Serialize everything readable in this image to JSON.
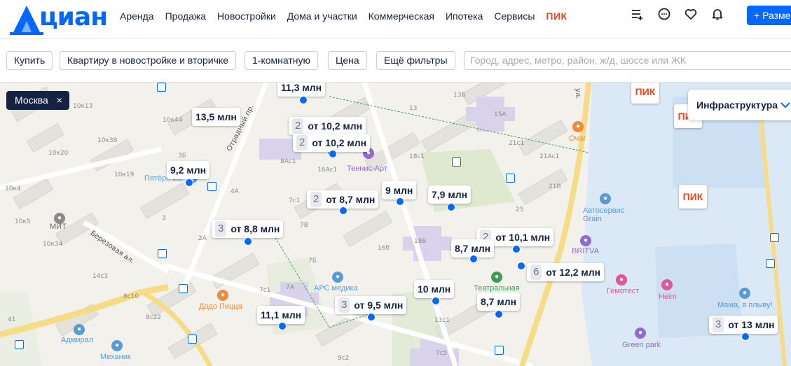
{
  "header": {
    "logo": "циан",
    "nav": [
      "Аренда",
      "Продажа",
      "Новостройки",
      "Дома и участки",
      "Коммерческая",
      "Ипотека",
      "Сервисы"
    ],
    "pik": "ПИК",
    "place_button": "+ Разме"
  },
  "filters": {
    "deal": "Купить",
    "type": "Квартиру в новостройке и вторичке",
    "rooms": "1-комнатную",
    "price": "Цена",
    "more": "Ещё фильтры",
    "search_placeholder": "Город, адрес, метро, район, ж/д, шоссе или ЖК"
  },
  "map": {
    "city_chip": "Москва",
    "city_chip_close": "×",
    "infrastructure": "Инфраструктура",
    "pik_label": "ПИК",
    "price_labels": [
      {
        "count": "",
        "price": "11,3 млн"
      },
      {
        "count": "",
        "price": "13,5 млн"
      },
      {
        "count": "2",
        "price": "от 10,2 млн"
      },
      {
        "count": "2",
        "price": "от 10,2 млн"
      },
      {
        "count": "",
        "price": "9,2 млн"
      },
      {
        "count": "2",
        "price": "от 8,7 млн"
      },
      {
        "count": "",
        "price": "9 млн"
      },
      {
        "count": "",
        "price": "7,9 млн"
      },
      {
        "count": "3",
        "price": "от 8,8 млн"
      },
      {
        "count": "2",
        "price": "от 10,1 млн"
      },
      {
        "count": "",
        "price": "8,7 млн"
      },
      {
        "count": "6",
        "price": "от 12,2 млн"
      },
      {
        "count": "",
        "price": "10 млн"
      },
      {
        "count": "3",
        "price": "от 9,5 млн"
      },
      {
        "count": "",
        "price": "8,7 млн"
      },
      {
        "count": "",
        "price": "11,1 млн"
      },
      {
        "count": "3",
        "price": "от 13 млн"
      }
    ],
    "pois": {
      "tennis": "Теннис-Арт",
      "pyaterochka": "Пятёрочка",
      "mit": "МИТ",
      "ars": "АРС медика",
      "dodo": "Додо Пицца",
      "admiral": "Адмирал",
      "mechanic": "Механик",
      "teatralnaya": "Театральная",
      "ochag": "Очаг",
      "autoservice": "Автосервис\nGrain",
      "britva": "BRITVA",
      "gemotest": "Гемотест",
      "heim": "Heim",
      "mama": "Мама, я плыву!",
      "greenpark": "Green park"
    },
    "streets": {
      "otradny": "Отрадный пр.",
      "berezovaya": "Березовая ал.",
      "ul": "ул."
    },
    "house_numbers": [
      "10к13",
      "10к44",
      "10к38",
      "10к20",
      "10к19",
      "10к4",
      "10к5",
      "10к34",
      "3Б",
      "4А",
      "2А",
      "3",
      "14с3",
      "8с10",
      "8с22",
      "9с2",
      "7с1",
      "7А",
      "7Б",
      "7В",
      "7с1",
      "8Ас1",
      "16Ас1",
      "16б",
      "18Б",
      "13",
      "13Б",
      "15А",
      "21с1",
      "21Ас1",
      "21В",
      "25",
      "18с1",
      "13с1",
      "41",
      "7с5"
    ]
  },
  "colors": {
    "brand": "#0468ff",
    "pik": "#f5441c",
    "text": "#152242"
  }
}
